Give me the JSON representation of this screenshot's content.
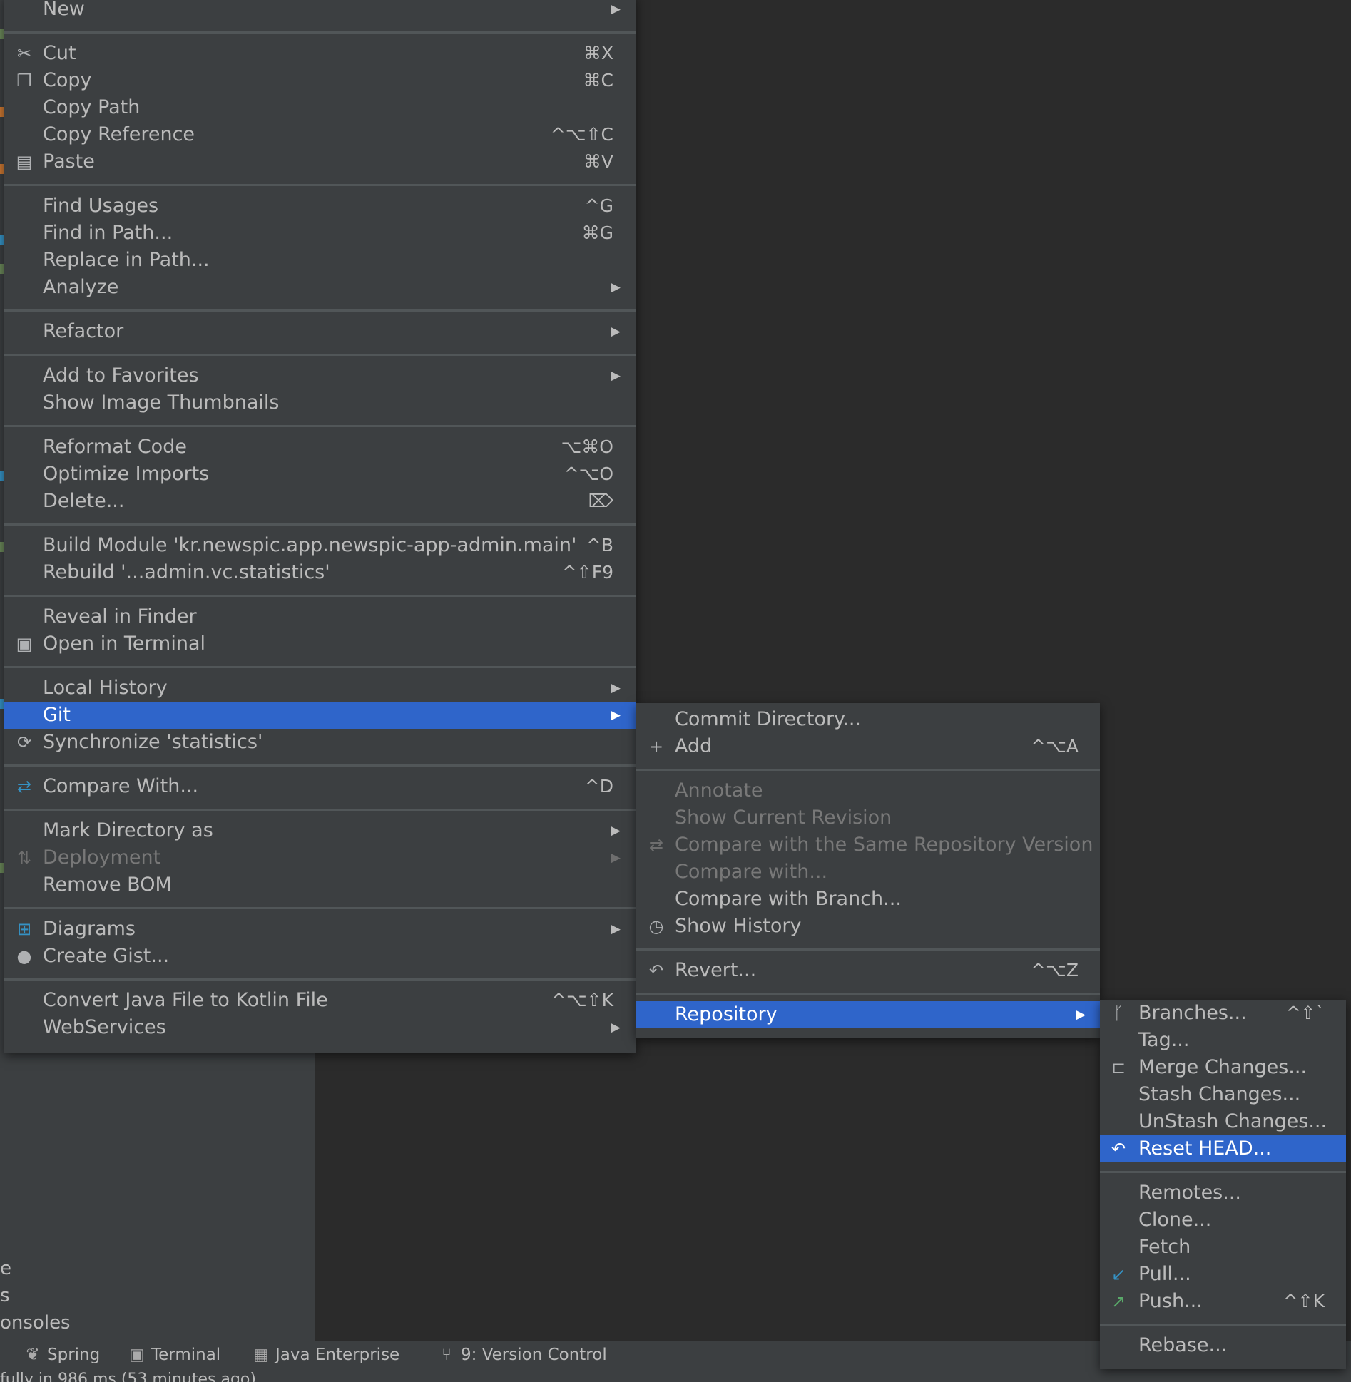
{
  "colors": {
    "menu_bg": "#3c3f41",
    "editor_bg": "#2b2b2b",
    "selection": "#2f65ca",
    "text": "#bbbbbb",
    "disabled_text": "#787878",
    "separator": "#515658"
  },
  "left_fragments": [
    "e",
    "s",
    "onsoles"
  ],
  "tool_windows": [
    {
      "label": "Spring",
      "icon": "spring-icon"
    },
    {
      "label": "Terminal",
      "icon": "terminal-icon"
    },
    {
      "label": "Java Enterprise",
      "icon": "java-enterprise-icon"
    },
    {
      "label": "9: Version Control",
      "icon": "version-control-icon"
    }
  ],
  "status_text": "fully in 986 ms (53 minutes ago)",
  "main_menu": {
    "items": [
      {
        "label": "New",
        "shortcut": "",
        "submenu": true,
        "icon": ""
      },
      {
        "label": "Cut",
        "shortcut": "⌘X",
        "submenu": false,
        "icon": "✂"
      },
      {
        "label": "Copy",
        "shortcut": "⌘C",
        "submenu": false,
        "icon": "❐"
      },
      {
        "label": "Copy Path",
        "shortcut": "",
        "submenu": false,
        "icon": ""
      },
      {
        "label": "Copy Reference",
        "shortcut": "^⌥⇧C",
        "submenu": false,
        "icon": ""
      },
      {
        "label": "Paste",
        "shortcut": "⌘V",
        "submenu": false,
        "icon": "📋"
      },
      {
        "label": "Find Usages",
        "shortcut": "^G",
        "submenu": false,
        "icon": ""
      },
      {
        "label": "Find in Path...",
        "shortcut": "⌘G",
        "submenu": false,
        "icon": ""
      },
      {
        "label": "Replace in Path...",
        "shortcut": "",
        "submenu": false,
        "icon": ""
      },
      {
        "label": "Analyze",
        "shortcut": "",
        "submenu": true,
        "icon": ""
      },
      {
        "label": "Refactor",
        "shortcut": "",
        "submenu": true,
        "icon": ""
      },
      {
        "label": "Add to Favorites",
        "shortcut": "",
        "submenu": true,
        "icon": ""
      },
      {
        "label": "Show Image Thumbnails",
        "shortcut": "",
        "submenu": false,
        "icon": ""
      },
      {
        "label": "Reformat Code",
        "shortcut": "⌥⌘O",
        "submenu": false,
        "icon": ""
      },
      {
        "label": "Optimize Imports",
        "shortcut": "^⌥O",
        "submenu": false,
        "icon": ""
      },
      {
        "label": "Delete...",
        "shortcut": "⌦",
        "submenu": false,
        "icon": ""
      },
      {
        "label": "Build Module 'kr.newspic.app.newspic-app-admin.main'",
        "shortcut": "^B",
        "submenu": false,
        "icon": ""
      },
      {
        "label": "Rebuild '...admin.vc.statistics'",
        "shortcut": "^⇧F9",
        "submenu": false,
        "icon": ""
      },
      {
        "label": "Reveal in Finder",
        "shortcut": "",
        "submenu": false,
        "icon": ""
      },
      {
        "label": "Open in Terminal",
        "shortcut": "",
        "submenu": false,
        "icon": "▣"
      },
      {
        "label": "Local History",
        "shortcut": "",
        "submenu": true,
        "icon": ""
      },
      {
        "label": "Git",
        "shortcut": "",
        "submenu": true,
        "icon": "",
        "selected": true
      },
      {
        "label": "Synchronize 'statistics'",
        "shortcut": "",
        "submenu": false,
        "icon": "⟳"
      },
      {
        "label": "Compare With...",
        "shortcut": "^D",
        "submenu": false,
        "icon": "⇄"
      },
      {
        "label": "Mark Directory as",
        "shortcut": "",
        "submenu": true,
        "icon": ""
      },
      {
        "label": "Deployment",
        "shortcut": "",
        "submenu": true,
        "icon": "⇅",
        "disabled": true
      },
      {
        "label": "Remove BOM",
        "shortcut": "",
        "submenu": false,
        "icon": ""
      },
      {
        "label": "Diagrams",
        "shortcut": "",
        "submenu": true,
        "icon": "⊞"
      },
      {
        "label": "Create Gist...",
        "shortcut": "",
        "submenu": false,
        "icon": "●"
      },
      {
        "label": "Convert Java File to Kotlin File",
        "shortcut": "^⌥⇧K",
        "submenu": false,
        "icon": ""
      },
      {
        "label": "WebServices",
        "shortcut": "",
        "submenu": true,
        "icon": ""
      }
    ]
  },
  "git_menu": {
    "items": [
      {
        "label": "Commit Directory...",
        "shortcut": "",
        "submenu": false,
        "icon": ""
      },
      {
        "label": "Add",
        "shortcut": "^⌥A",
        "submenu": false,
        "icon": "+"
      },
      {
        "label": "Annotate",
        "shortcut": "",
        "submenu": false,
        "icon": "",
        "disabled": true
      },
      {
        "label": "Show Current Revision",
        "shortcut": "",
        "submenu": false,
        "icon": "",
        "disabled": true
      },
      {
        "label": "Compare with the Same Repository Version",
        "shortcut": "",
        "submenu": false,
        "icon": "⇄",
        "disabled": true
      },
      {
        "label": "Compare with...",
        "shortcut": "",
        "submenu": false,
        "icon": "",
        "disabled": true
      },
      {
        "label": "Compare with Branch...",
        "shortcut": "",
        "submenu": false,
        "icon": ""
      },
      {
        "label": "Show History",
        "shortcut": "",
        "submenu": false,
        "icon": "◷"
      },
      {
        "label": "Revert...",
        "shortcut": "^⌥Z",
        "submenu": false,
        "icon": "↶"
      },
      {
        "label": "Repository",
        "shortcut": "",
        "submenu": true,
        "icon": "",
        "selected": true
      }
    ]
  },
  "repo_menu": {
    "items": [
      {
        "label": "Branches...",
        "shortcut": "^⇧`",
        "icon": "ᚴ"
      },
      {
        "label": "Tag...",
        "shortcut": "",
        "icon": ""
      },
      {
        "label": "Merge Changes...",
        "shortcut": "",
        "icon": "⊏"
      },
      {
        "label": "Stash Changes...",
        "shortcut": "",
        "icon": ""
      },
      {
        "label": "UnStash Changes...",
        "shortcut": "",
        "icon": ""
      },
      {
        "label": "Reset HEAD...",
        "shortcut": "",
        "icon": "↶",
        "selected": true
      },
      {
        "label": "Remotes...",
        "shortcut": "",
        "icon": ""
      },
      {
        "label": "Clone...",
        "shortcut": "",
        "icon": ""
      },
      {
        "label": "Fetch",
        "shortcut": "",
        "icon": ""
      },
      {
        "label": "Pull...",
        "shortcut": "",
        "icon": "↙"
      },
      {
        "label": "Push...",
        "shortcut": "^⇧K",
        "icon": "↗"
      },
      {
        "label": "Rebase...",
        "shortcut": "",
        "icon": ""
      }
    ]
  }
}
